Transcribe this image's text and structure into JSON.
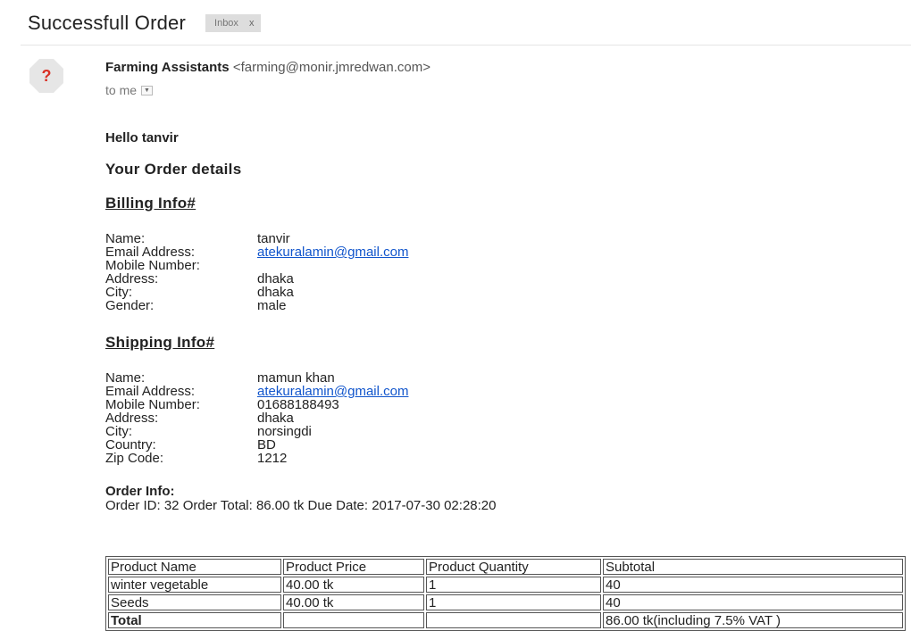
{
  "email": {
    "subject": "Successfull Order",
    "label": "Inbox",
    "label_close": "x",
    "sender_name": "Farming Assistants",
    "sender_email": "<farming@monir.jmredwan.com>",
    "avatar_glyph": "?",
    "to_line": "to me"
  },
  "content": {
    "greeting": "Hello tanvir",
    "order_heading": "Your Order details",
    "billing": {
      "heading": "Billing Info#",
      "fields": [
        {
          "label": "Name:",
          "value": "tanvir"
        },
        {
          "label": "Email Address:",
          "value": "atekuralamin@gmail.com"
        },
        {
          "label": "Mobile Number:",
          "value": ""
        },
        {
          "label": "Address:",
          "value": "dhaka"
        },
        {
          "label": "City:",
          "value": "dhaka"
        },
        {
          "label": "Gender:",
          "value": "male"
        }
      ]
    },
    "shipping": {
      "heading": "Shipping Info#",
      "fields": [
        {
          "label": "Name:",
          "value": "mamun khan"
        },
        {
          "label": "Email Address:",
          "value": "atekuralamin@gmail.com"
        },
        {
          "label": "Mobile Number:",
          "value": "01688188493"
        },
        {
          "label": "Address:",
          "value": "dhaka"
        },
        {
          "label": "City:",
          "value": "norsingdi"
        },
        {
          "label": "Country:",
          "value": "BD"
        },
        {
          "label": "Zip Code:",
          "value": "1212"
        }
      ]
    },
    "order_info": {
      "heading": "Order Info:",
      "summary": "Order ID: 32 Order Total: 86.00 tk Due Date: 2017-07-30 02:28:20"
    },
    "table": {
      "headers": [
        "Product Name",
        "Product Price",
        "Product Quantity",
        "Subtotal"
      ],
      "rows": [
        [
          "winter vegetable",
          "40.00 tk",
          "1",
          "40"
        ],
        [
          "Seeds",
          "40.00 tk",
          "1",
          "40"
        ]
      ],
      "total_label": "Total",
      "total_value": "86.00 tk(including 7.5% VAT )"
    }
  }
}
